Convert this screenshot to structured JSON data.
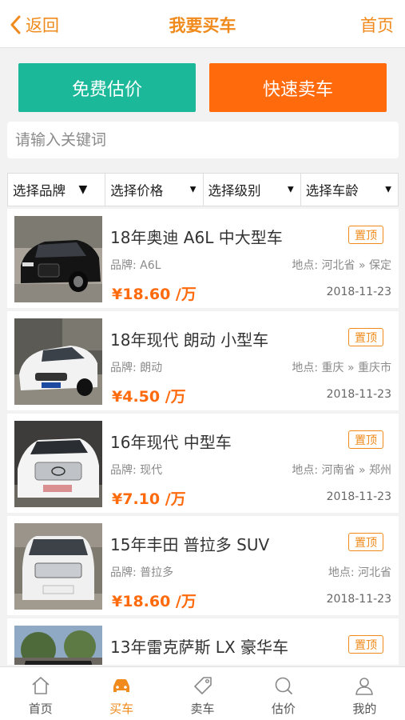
{
  "navbar": {
    "back_label": "返回",
    "title": "我要买车",
    "home_label": "首页"
  },
  "actions": {
    "evaluate_label": "免费估价",
    "sell_label": "快速卖车"
  },
  "search": {
    "placeholder": "请输入关键词",
    "value": ""
  },
  "filters": [
    "选择品牌",
    "选择价格",
    "选择级别",
    "选择车龄"
  ],
  "listings": [
    {
      "title": "18年奥迪 A6L 中大型车",
      "badge": "置顶",
      "brand": "品牌: A6L",
      "location": "地点: 河北省 » 保定",
      "price": "¥18.60 /万",
      "date": "2018-11-23"
    },
    {
      "title": "18年现代 朗动 小型车",
      "badge": "置顶",
      "brand": "品牌: 朗动",
      "location": "地点: 重庆 » 重庆市",
      "price": "¥4.50 /万",
      "date": "2018-11-23"
    },
    {
      "title": "16年现代 中型车",
      "badge": "置顶",
      "brand": "品牌: 现代",
      "location": "地点: 河南省 » 郑州",
      "price": "¥7.10 /万",
      "date": "2018-11-23"
    },
    {
      "title": "15年丰田 普拉多 SUV",
      "badge": "置顶",
      "brand": "品牌: 普拉多",
      "location": "地点: 河北省",
      "price": "¥18.60 /万",
      "date": "2018-11-23"
    },
    {
      "title": "13年雷克萨斯 LX 豪华车",
      "badge": "置顶",
      "brand": "",
      "location": "",
      "price": "",
      "date": ""
    }
  ],
  "tabbar": [
    {
      "label": "首页",
      "icon": "home-icon"
    },
    {
      "label": "买车",
      "icon": "car-icon",
      "active": true
    },
    {
      "label": "卖车",
      "icon": "tag-icon"
    },
    {
      "label": "估价",
      "icon": "search-icon"
    },
    {
      "label": "我的",
      "icon": "user-icon"
    }
  ],
  "colors": {
    "accent": "#f08a1c",
    "evaluate_button": "#1cb89a",
    "sell_button": "#ff6a0d"
  }
}
